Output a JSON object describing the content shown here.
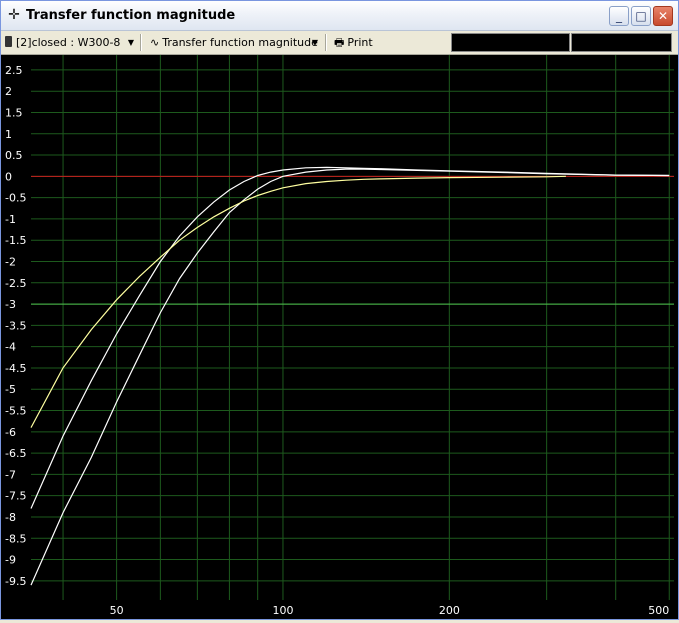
{
  "window": {
    "title": "Transfer function magnitude",
    "title_icon": "crosshair-icon",
    "controls": {
      "minimize": "_",
      "maximize": "□",
      "close": "✕"
    }
  },
  "toolbar": {
    "source_label": "[2]closed : W300-8",
    "view_label": "Transfer function magnitude",
    "print_label": "Print",
    "dropdown_glyph": "▼"
  },
  "colors": {
    "background": "#000000",
    "grid": "#1d5a1d",
    "zero_line": "#c81e1e",
    "minus3_line": "#4ec04e",
    "curve_white": "#ffffff",
    "curve_yellow": "#ffffa0"
  },
  "chart_data": {
    "type": "line",
    "x_scale": "log",
    "xlim": [
      35,
      510
    ],
    "ylim": [
      -9.95,
      2.85
    ],
    "x_tick_labels": [
      {
        "value": 50,
        "label": "50"
      },
      {
        "value": 100,
        "label": "100"
      },
      {
        "value": 200,
        "label": "200"
      },
      {
        "value": 500,
        "label": "500"
      }
    ],
    "x_grid": [
      40,
      50,
      60,
      70,
      80,
      90,
      100,
      200,
      300,
      400,
      500
    ],
    "y_tick_labels": [
      "2.5",
      "2",
      "1.5",
      "1",
      "0.5",
      "0",
      "-0.5",
      "-1",
      "-1.5",
      "-2",
      "-2.5",
      "-3",
      "-3.5",
      "-4",
      "-4.5",
      "-5",
      "-5.5",
      "-6",
      "-6.5",
      "-7",
      "-7.5",
      "-8",
      "-8.5",
      "-9",
      "-9.5"
    ],
    "y_ticks": [
      2.5,
      2,
      1.5,
      1,
      0.5,
      0,
      -0.5,
      -1,
      -1.5,
      -2,
      -2.5,
      -3,
      -3.5,
      -4,
      -4.5,
      -5,
      -5.5,
      -6,
      -6.5,
      -7,
      -7.5,
      -8,
      -8.5,
      -9,
      -9.5
    ],
    "reference_lines": [
      {
        "y": 0,
        "color": "#c81e1e"
      },
      {
        "y": -3,
        "color": "#4ec04e"
      }
    ],
    "series": [
      {
        "color": "#ffffff",
        "x": [
          35,
          40,
          45,
          50,
          55,
          60,
          65,
          70,
          75,
          80,
          85,
          90,
          95,
          100,
          110,
          120,
          130,
          140,
          150,
          175,
          200,
          250,
          300,
          400,
          500
        ],
        "y": [
          -9.6,
          -7.9,
          -6.6,
          -5.3,
          -4.2,
          -3.2,
          -2.4,
          -1.8,
          -1.3,
          -0.85,
          -0.55,
          -0.3,
          -0.12,
          0,
          0.1,
          0.15,
          0.17,
          0.17,
          0.16,
          0.14,
          0.12,
          0.09,
          0.06,
          0.03,
          0.02
        ]
      },
      {
        "color": "#ffffff",
        "x": [
          35,
          40,
          45,
          50,
          55,
          60,
          65,
          70,
          75,
          80,
          85,
          90,
          95,
          100,
          110,
          120,
          130,
          140,
          150,
          175,
          200,
          250,
          300,
          400,
          500
        ],
        "y": [
          -7.8,
          -6.1,
          -4.8,
          -3.7,
          -2.8,
          -2.0,
          -1.4,
          -0.95,
          -0.6,
          -0.32,
          -0.12,
          0.02,
          0.1,
          0.15,
          0.2,
          0.21,
          0.2,
          0.19,
          0.18,
          0.15,
          0.13,
          0.1,
          0.07,
          0.03,
          0.02
        ]
      },
      {
        "color": "#ffffa0",
        "x": [
          35,
          40,
          45,
          50,
          55,
          60,
          65,
          70,
          75,
          80,
          85,
          90,
          95,
          100,
          110,
          120,
          130,
          140,
          150,
          175,
          200,
          250,
          300,
          325
        ],
        "y": [
          -5.9,
          -4.5,
          -3.6,
          -2.9,
          -2.35,
          -1.9,
          -1.5,
          -1.2,
          -0.95,
          -0.75,
          -0.58,
          -0.45,
          -0.35,
          -0.27,
          -0.17,
          -0.12,
          -0.09,
          -0.07,
          -0.06,
          -0.04,
          -0.03,
          -0.02,
          -0.01,
          0
        ]
      }
    ]
  }
}
